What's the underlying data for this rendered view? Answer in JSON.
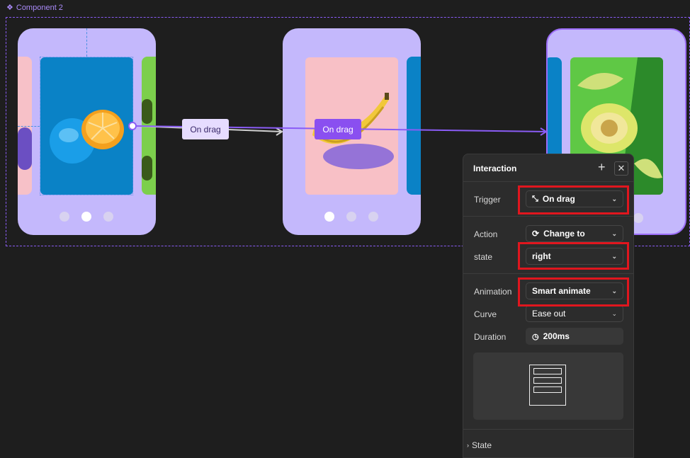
{
  "canvas": {
    "component_label": "Component 2",
    "connector_label_1": "On drag",
    "connector_label_2": "On drag"
  },
  "interaction_panel": {
    "title": "Interaction",
    "trigger": {
      "label": "Trigger",
      "value": "On drag"
    },
    "action": {
      "label": "Action",
      "value": "Change to"
    },
    "state_field": {
      "label": "state",
      "value": "right"
    },
    "animation": {
      "label": "Animation",
      "value": "Smart animate"
    },
    "curve": {
      "label": "Curve",
      "value": "Ease out"
    },
    "duration": {
      "label": "Duration",
      "value": "200ms"
    },
    "state_section": "State"
  },
  "colors": {
    "canvas_bg": "#1e1e1e",
    "accent": "#8a5cf5",
    "phone_bg": "#c4b8fc",
    "highlight": "#e0161e"
  }
}
